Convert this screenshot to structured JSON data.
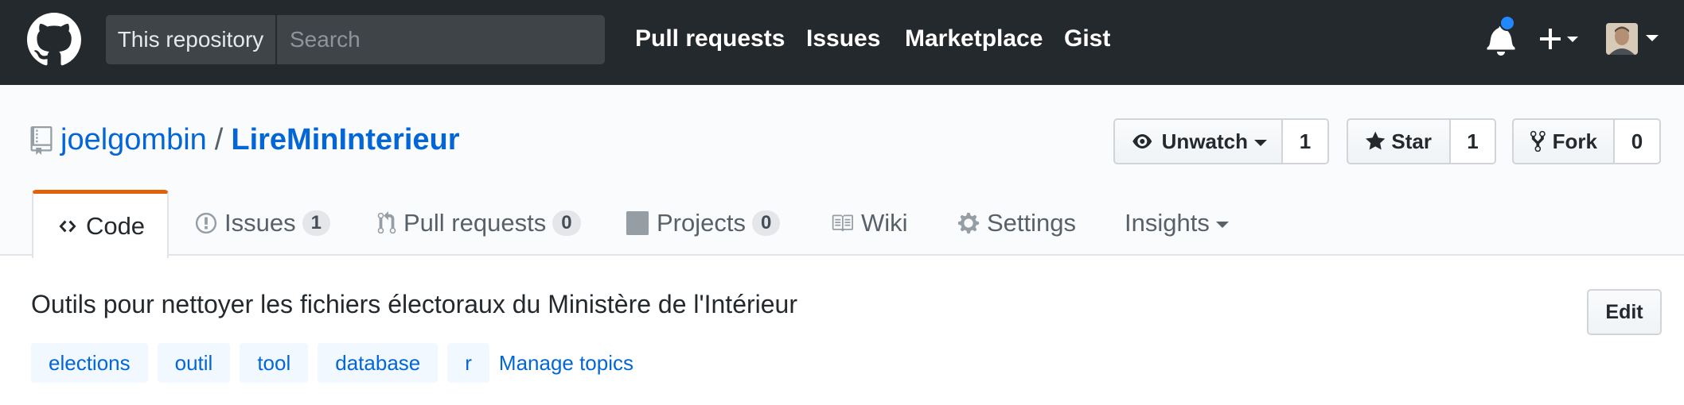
{
  "header": {
    "scope_label": "This repository",
    "search_placeholder": "Search",
    "nav": [
      "Pull requests",
      "Issues",
      "Marketplace",
      "Gist"
    ],
    "notification_dot_color": "#2188ff"
  },
  "repo": {
    "owner": "joelgombin",
    "separator": "/",
    "name": "LireMinInterieur",
    "actions": {
      "watch": {
        "label": "Unwatch",
        "count": "1"
      },
      "star": {
        "label": "Star",
        "count": "1"
      },
      "fork": {
        "label": "Fork",
        "count": "0"
      }
    },
    "tabs": [
      {
        "label": "Code",
        "icon": "code-icon"
      },
      {
        "label": "Issues",
        "counter": "1",
        "icon": "issue-icon"
      },
      {
        "label": "Pull requests",
        "counter": "0",
        "icon": "pull-request-icon"
      },
      {
        "label": "Projects",
        "counter": "0",
        "icon": "project-icon"
      },
      {
        "label": "Wiki",
        "icon": "book-icon"
      },
      {
        "label": "Settings",
        "icon": "gear-icon"
      },
      {
        "label": "Insights",
        "icon": "caret-down-icon"
      }
    ],
    "selected_tab_accent": "#e36209"
  },
  "about": {
    "description": "Outils pour nettoyer les fichiers électoraux du Ministère de l'Intérieur",
    "edit_label": "Edit",
    "topics": [
      "elections",
      "outil",
      "tool",
      "database",
      "r"
    ],
    "manage_topics": "Manage topics"
  },
  "colors": {
    "header_bg": "#24292e",
    "link": "#0366d6",
    "topic_bg": "#f1f8ff"
  }
}
